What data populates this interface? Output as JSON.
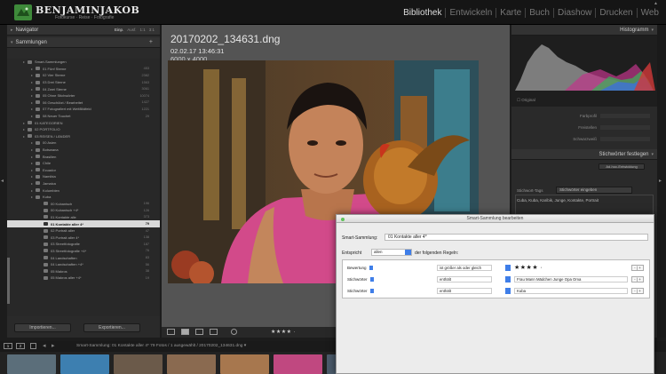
{
  "brand": {
    "name": "BENJAMINJAKOB",
    "sub": "Fotokurse · Reise · Fotografie"
  },
  "modules": [
    "Bibliothek",
    "Entwickeln",
    "Karte",
    "Buch",
    "Diashow",
    "Drucken",
    "Web"
  ],
  "active_module": "Bibliothek",
  "left": {
    "navigator": "Navigator",
    "nav_modes": [
      "Einp.",
      "Ausf.",
      "1:1",
      "3:1"
    ],
    "collections": "Sammlungen",
    "rows": [
      {
        "label": "Smart-Sammlungen",
        "count": "",
        "depth": 1,
        "sel": false
      },
      {
        "label": "01 Fünf Sterne",
        "count": "453",
        "depth": 2,
        "sel": false
      },
      {
        "label": "02 Vier Sterne",
        "count": "2382",
        "depth": 2,
        "sel": false
      },
      {
        "label": "03 Drei Sterne",
        "count": "1563",
        "depth": 2,
        "sel": false
      },
      {
        "label": "04 Zwei Sterne",
        "count": "3061",
        "depth": 2,
        "sel": false
      },
      {
        "label": "05 Ohne Stichwörter",
        "count": "10074",
        "depth": 2,
        "sel": false
      },
      {
        "label": "06 Geschützt / Bearbeitet",
        "count": "1427",
        "depth": 2,
        "sel": false
      },
      {
        "label": "07 Fotografiert mit WeitBildfeld",
        "count": "1221",
        "depth": 2,
        "sel": false
      },
      {
        "label": "08 Neuer Touchet",
        "count": "29",
        "depth": 2,
        "sel": false
      },
      {
        "label": "01 KATEGORIEN",
        "count": "",
        "depth": 1,
        "sel": false
      },
      {
        "label": "02 PORTFOLIO",
        "count": "",
        "depth": 1,
        "sel": false
      },
      {
        "label": "03 REISEN / LÄNDER",
        "count": "",
        "depth": 1,
        "sel": false
      },
      {
        "label": "00 Asien",
        "count": "",
        "depth": 2,
        "sel": false
      },
      {
        "label": "Botswana",
        "count": "",
        "depth": 2,
        "sel": false
      },
      {
        "label": "Brasilien",
        "count": "",
        "depth": 2,
        "sel": false
      },
      {
        "label": "Chile",
        "count": "",
        "depth": 2,
        "sel": false
      },
      {
        "label": "Ecuador",
        "count": "",
        "depth": 2,
        "sel": false
      },
      {
        "label": "Namibia",
        "count": "",
        "depth": 2,
        "sel": false
      },
      {
        "label": "Jamaica",
        "count": "",
        "depth": 2,
        "sel": false
      },
      {
        "label": "Kolumbien",
        "count": "",
        "depth": 2,
        "sel": false
      },
      {
        "label": "Kuba",
        "count": "",
        "depth": 2,
        "sel": false
      },
      {
        "label": "00 Kubanisch",
        "count": "196",
        "depth": 3,
        "sel": false
      },
      {
        "label": "00 Kubanisch +4*",
        "count": "126",
        "depth": 3,
        "sel": false
      },
      {
        "label": "01 Kontakte alle",
        "count": "373",
        "depth": 3,
        "sel": false
      },
      {
        "label": "01 Kontakte aller 4*",
        "count": "79",
        "depth": 3,
        "sel": true
      },
      {
        "label": "02 Portrait aller",
        "count": "47",
        "depth": 3,
        "sel": false
      },
      {
        "label": "03 Portrait aller 4*",
        "count": "138",
        "depth": 3,
        "sel": false
      },
      {
        "label": "03 Streetfotografie",
        "count": "187",
        "depth": 3,
        "sel": false
      },
      {
        "label": "03 Streetfotografie +4*",
        "count": "76",
        "depth": 3,
        "sel": false
      },
      {
        "label": "04 Landschaften",
        "count": "83",
        "depth": 3,
        "sel": false
      },
      {
        "label": "04 Landschaften +4*",
        "count": "56",
        "depth": 3,
        "sel": false
      },
      {
        "label": "05 Makros",
        "count": "38",
        "depth": 3,
        "sel": false
      },
      {
        "label": "05 Makros aller +4*",
        "count": "19",
        "depth": 3,
        "sel": false
      }
    ],
    "import_btn": "Importieren...",
    "export_btn": "Exportieren..."
  },
  "image": {
    "filename": "20170202_134631.dng",
    "datetime": "02.02.17 13:46:31",
    "dimensions": "6000 x 4000"
  },
  "toolbar": {
    "stars": "★★★★ ·"
  },
  "right": {
    "histogram": "Histogramm",
    "original": "Original",
    "fields": [
      {
        "key": "Farbprofil"
      },
      {
        "key": "Freistellen"
      },
      {
        "key": "Schwarzweiß"
      }
    ],
    "sb_btn": "Ad-hoc-Entwicklung",
    "keywords_header": "Stichwörter festlegen",
    "kw_label": "Stichwort-Tags",
    "kw_select": "Stichwörter eingeben",
    "kw_text": "Cuba, Kuba, Karibik, Junge, Kontakte, Portrait"
  },
  "filmstrip_bar": {
    "n1": "1",
    "n2": "2",
    "info": "Smart-Sammlung: 01 Kontakte aller 4*   79 Fotos / 1 ausgewählt / 20170202_134631.dng ▾"
  },
  "dialog": {
    "title": "Smart-Sammlung bearbeiten",
    "name_label": "Smart-Sammlung:",
    "name_value": "01 Kontakte aller 4*",
    "match_label": "Entspricht",
    "match_value": "allen",
    "match_suffix": "der folgenden Regeln:",
    "rules": [
      {
        "field": "Bewertung",
        "op": "ist größer als oder gleich",
        "value": "",
        "stars": "★★★★ ·"
      },
      {
        "field": "Stichwörter",
        "op": "enthält",
        "value": "Frau Mann Mädchen Junge Opa Oma",
        "stars": ""
      },
      {
        "field": "Stichwörter",
        "op": "enthält",
        "value": "Kuba",
        "stars": ""
      }
    ],
    "pm": "- | +"
  }
}
